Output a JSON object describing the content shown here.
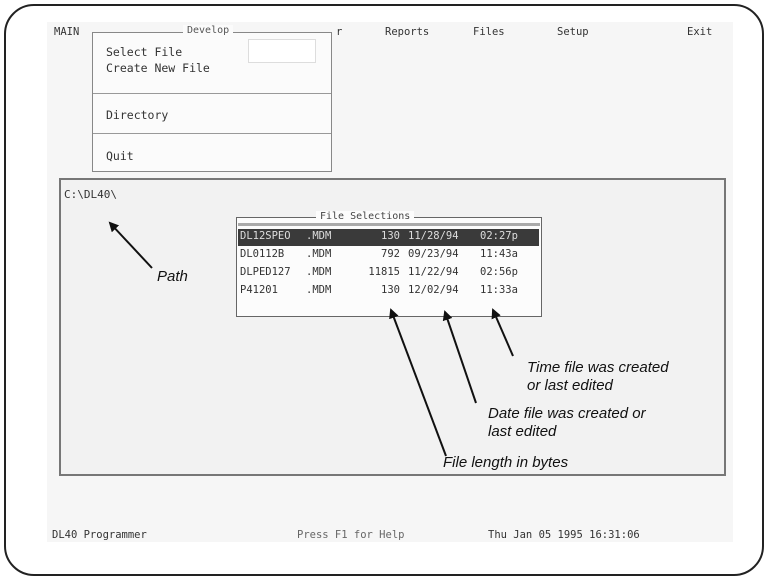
{
  "menubar": {
    "items": [
      "MAIN",
      "r",
      "Reports",
      "Files",
      "Setup",
      "Exit"
    ]
  },
  "dropdown": {
    "title": "Develop",
    "items": [
      "Select File",
      "Create New File",
      "Directory",
      "Quit"
    ]
  },
  "directory": {
    "path": "C:\\DL40\\"
  },
  "file_selections": {
    "title": "File Selections",
    "rows": [
      {
        "name": "DL12SPEO",
        "ext": ".MDM",
        "size": "130",
        "date": "11/28/94",
        "time": "02:27p",
        "selected": true
      },
      {
        "name": "DL0112B",
        "ext": ".MDM",
        "size": "792",
        "date": "09/23/94",
        "time": "11:43a",
        "selected": false
      },
      {
        "name": "DLPED127",
        "ext": ".MDM",
        "size": "11815",
        "date": "11/22/94",
        "time": "02:56p",
        "selected": false
      },
      {
        "name": "P41201",
        "ext": ".MDM",
        "size": "130",
        "date": "12/02/94",
        "time": "11:33a",
        "selected": false
      }
    ]
  },
  "statusbar": {
    "app": "DL40 Programmer",
    "help": "Press F1 for Help",
    "datetime": "Thu Jan 05 1995 16:31:06"
  },
  "annotations": {
    "path": "Path",
    "time_line1": "Time file was created",
    "time_line2": "or last edited",
    "date_line1": "Date file was created or",
    "date_line2": "last edited",
    "length": "File length in bytes"
  }
}
